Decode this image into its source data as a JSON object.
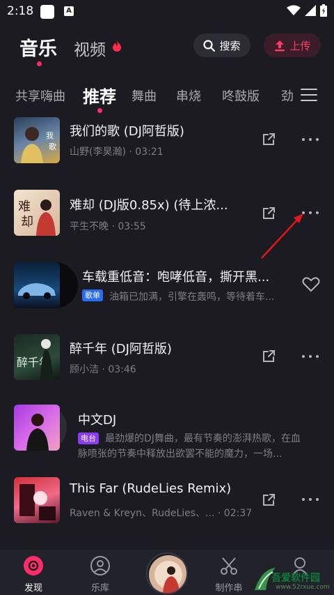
{
  "status_bar": {
    "time": "2:18"
  },
  "header": {
    "tab_music": "音乐",
    "tab_video": "视频",
    "search_label": "搜索",
    "upload_label": "上传"
  },
  "categories": [
    "共享嗨曲",
    "推荐",
    "舞曲",
    "串烧",
    "咚鼓版",
    "劲"
  ],
  "songs": [
    {
      "title": "我们的歌 (DJ阿哲版)",
      "artist": "山野(李昊瀚)",
      "duration": "03:21"
    },
    {
      "title": "难却 (DJ版0.85x) (待上浓...",
      "artist": "平生不晚",
      "duration": "03:55"
    },
    {
      "title": "车载重低音：咆哮低音，撕开黑...",
      "badge": "歌单",
      "desc": "油箱已加满，引擎在轰鸣，等待着车..."
    },
    {
      "title": "醉千年 (DJ阿哲版)",
      "artist": "顾小洁",
      "duration": "03:46"
    },
    {
      "title": "中文DJ",
      "badge": "电台",
      "desc_line1": "最劲爆的DJ舞曲，最有节奏的澎湃热歌，在血",
      "desc_line2": "脉喷张的节奏中释放出欲罢不能的魔力，一场..."
    },
    {
      "title": "This Far (RudeLies Remix)",
      "artist": "Raven & Kreyn、RudeLies、...",
      "duration": "02:37"
    }
  ],
  "separator": "·",
  "bottom_nav": {
    "discover": "发现",
    "library": "乐库",
    "create": "制作串"
  },
  "watermark": {
    "text": "吾爱软件园",
    "url": "www.52rxue.com"
  },
  "colors": {
    "accent": "#ff2c6a",
    "background": "#1b1b21",
    "badge_playlist": "#2a6cf0",
    "badge_radio": "#8b3cf0"
  }
}
